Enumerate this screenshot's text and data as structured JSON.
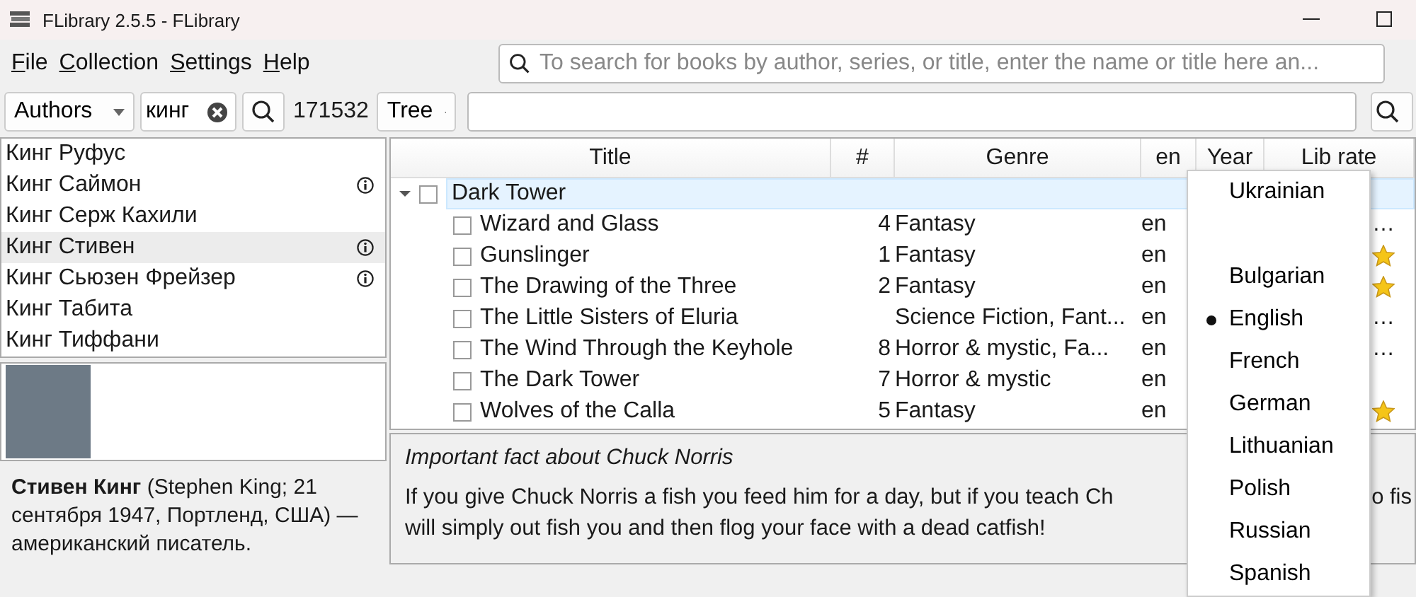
{
  "window": {
    "title": "FLibrary 2.5.5 - FLibrary"
  },
  "menu_bar": [
    "File",
    "Collection",
    "Settings",
    "Help"
  ],
  "top_search": {
    "placeholder": "To search for books by author, series, or title, enter the name or title here an..."
  },
  "toolbar": {
    "mode": "Authors",
    "search_value": "кинг",
    "count": "171532",
    "view": "Tree"
  },
  "authors": [
    {
      "name": "Кинг Руфус",
      "info": false,
      "selected": false
    },
    {
      "name": "Кинг Саймон",
      "info": true,
      "selected": false
    },
    {
      "name": "Кинг Серж Кахили",
      "info": false,
      "selected": false
    },
    {
      "name": "Кинг Стивен",
      "info": true,
      "selected": true
    },
    {
      "name": "Кинг Сьюзен Фрейзер",
      "info": true,
      "selected": false
    },
    {
      "name": "Кинг Табита",
      "info": false,
      "selected": false
    },
    {
      "name": "Кинг Тиффани",
      "info": false,
      "selected": false
    }
  ],
  "author_bio": "**Стивен Кинг** (Stephen King; 21 сентября 1947, Портленд, США) — американский писатель.",
  "book_table": {
    "columns": [
      "Title",
      "#",
      "Genre",
      "en",
      "Year",
      "Lib rate"
    ],
    "groups": [
      {
        "title": "Dark Tower",
        "expanded": true,
        "checked": false,
        "selected": true,
        "children": [
          {
            "title": "Wizard and Glass",
            "num": "4",
            "genre": "Fantasy",
            "lang": "en",
            "lib_rate": {
              "kind": "text",
              "text": "…"
            },
            "checked": false
          },
          {
            "title": "Gunslinger",
            "num": "1",
            "genre": "Fantasy",
            "lang": "en",
            "lib_rate": {
              "kind": "star"
            },
            "checked": false
          },
          {
            "title": "The Drawing of the Three",
            "num": "2",
            "genre": "Fantasy",
            "lang": "en",
            "lib_rate": {
              "kind": "star"
            },
            "checked": false
          },
          {
            "title": "The Little Sisters of Eluria",
            "genre": "Science Fiction, Fant...",
            "lang": "en",
            "lib_rate": {
              "kind": "text",
              "text": "…"
            },
            "checked": false
          },
          {
            "title": "The Wind Through the Keyhole",
            "num": "8",
            "genre": "Horror & mystic, Fa...",
            "lang": "en",
            "lib_rate": {
              "kind": "text",
              "text": "…"
            },
            "checked": false
          },
          {
            "title": "The Dark Tower",
            "num": "7",
            "genre": "Horror & mystic",
            "lang": "en",
            "checked": false
          },
          {
            "title": "Wolves of the Calla",
            "num": "5",
            "genre": "Fantasy",
            "lang": "en",
            "lib_rate": {
              "kind": "star"
            },
            "checked": false
          }
        ]
      }
    ]
  },
  "fact": {
    "title": "Important fact about Chuck Norris",
    "lines": [
      "If you give Chuck Norris a fish you feed him for a day, but if you teach Ch",
      "will simply out fish you and then flog your face with a dead catfish!"
    ],
    "cut_fragment": "o fis"
  },
  "language_menu": [
    {
      "kind": "item",
      "label": "Ukrainian",
      "selected": false
    },
    {
      "kind": "spacer"
    },
    {
      "kind": "item",
      "label": "Bulgarian",
      "selected": false
    },
    {
      "kind": "item",
      "label": "English",
      "selected": true
    },
    {
      "kind": "item",
      "label": "French",
      "selected": false
    },
    {
      "kind": "item",
      "label": "German",
      "selected": false
    },
    {
      "kind": "item",
      "label": "Lithuanian",
      "selected": false
    },
    {
      "kind": "item",
      "label": "Polish",
      "selected": false
    },
    {
      "kind": "item",
      "label": "Russian",
      "selected": false
    },
    {
      "kind": "item",
      "label": "Spanish",
      "selected": false
    }
  ]
}
